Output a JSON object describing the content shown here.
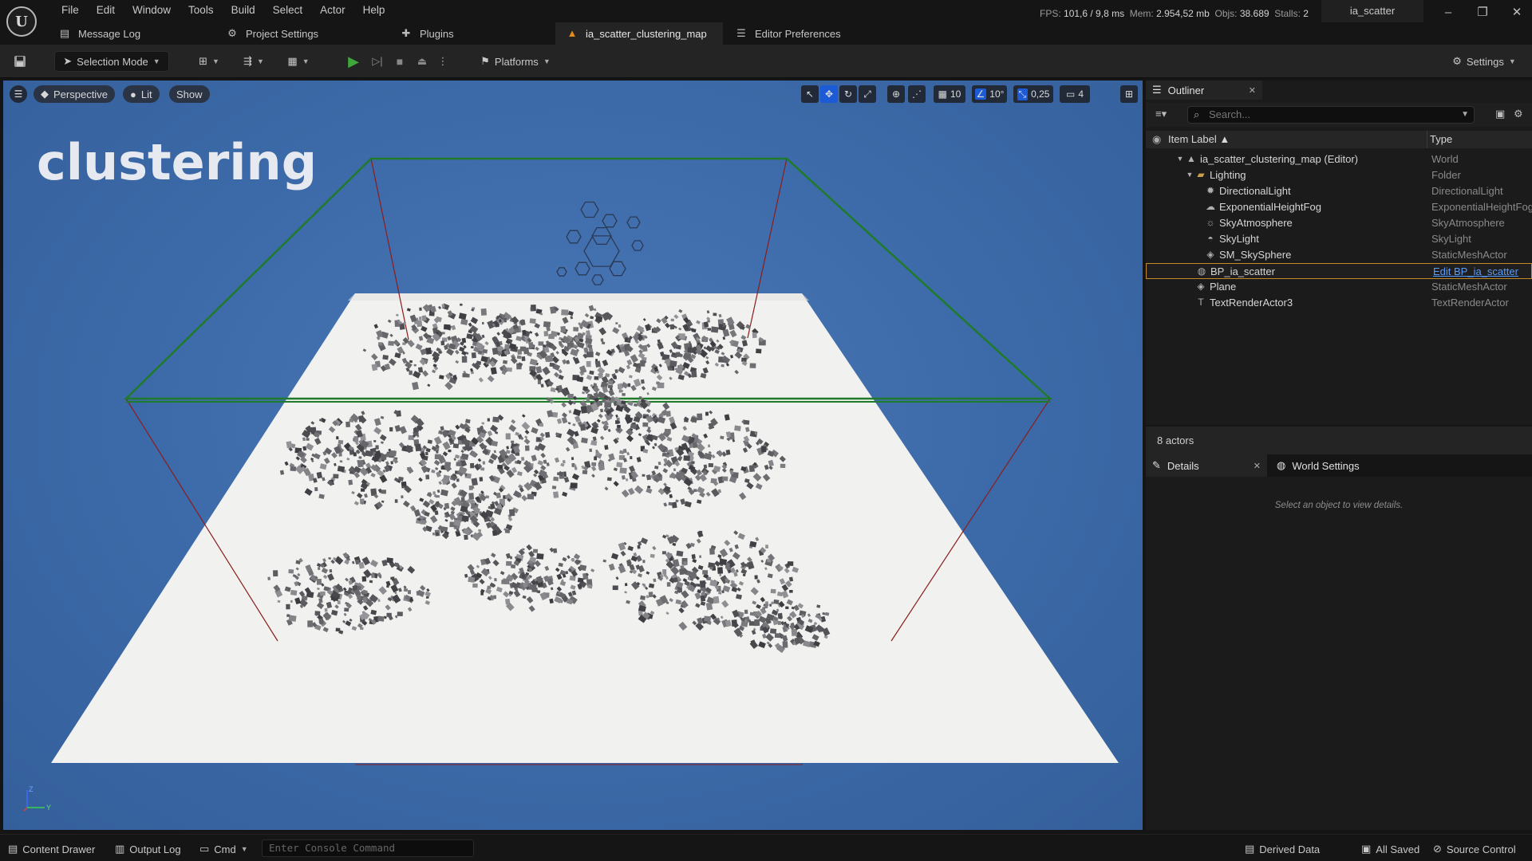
{
  "menu": [
    "File",
    "Edit",
    "Window",
    "Tools",
    "Build",
    "Select",
    "Actor",
    "Help"
  ],
  "stats": {
    "fps_label": "FPS:",
    "fps": "101,6",
    "ms": "/ 9,8 ms",
    "mem_label": "Mem:",
    "mem": "2.954,52 mb",
    "objs_label": "Objs:",
    "objs": "38.689",
    "stalls_label": "Stalls:",
    "stalls": "2"
  },
  "project_name": "ia_scatter",
  "window_controls": {
    "minimize": "–",
    "restore": "❐",
    "close": "✕"
  },
  "tabs": {
    "message_log": "Message Log",
    "project_settings": "Project Settings",
    "plugins": "Plugins",
    "level": "ia_scatter_clustering_map",
    "editor_prefs": "Editor Preferences"
  },
  "toolbar": {
    "selection_mode": "Selection Mode",
    "platforms": "Platforms",
    "settings": "Settings"
  },
  "viewport": {
    "perspective": "Perspective",
    "lit": "Lit",
    "show": "Show",
    "grid_snap": "10",
    "rot_snap": "10°",
    "scale_snap": "0,25",
    "camera_speed": "4",
    "world_text": "clustering",
    "axis_z": "Z",
    "axis_y": "Y"
  },
  "outliner": {
    "title": "Outliner",
    "search_placeholder": "Search...",
    "col_label": "Item Label ▲",
    "col_type": "Type",
    "rows": [
      {
        "label": "ia_scatter_clustering_map (Editor)",
        "type": "World"
      },
      {
        "label": "Lighting",
        "type": "Folder"
      },
      {
        "label": "DirectionalLight",
        "type": "DirectionalLight"
      },
      {
        "label": "ExponentialHeightFog",
        "type": "ExponentialHeightFog"
      },
      {
        "label": "SkyAtmosphere",
        "type": "SkyAtmosphere"
      },
      {
        "label": "SkyLight",
        "type": "SkyLight"
      },
      {
        "label": "SM_SkySphere",
        "type": "StaticMeshActor"
      },
      {
        "label": "BP_ia_scatter",
        "type": "Edit BP_ia_scatter"
      },
      {
        "label": "Plane",
        "type": "StaticMeshActor"
      },
      {
        "label": "TextRenderActor3",
        "type": "TextRenderActor"
      }
    ],
    "footer": "8 actors"
  },
  "details": {
    "tab_details": "Details",
    "tab_world": "World Settings",
    "empty_message": "Select an object to view details."
  },
  "statusbar": {
    "content_drawer": "Content Drawer",
    "output_log": "Output Log",
    "cmd": "Cmd",
    "console_placeholder": "Enter Console Command",
    "derived_data": "Derived Data",
    "all_saved": "All Saved",
    "source_control": "Source Control"
  },
  "colors": {
    "accent_blue": "#1d5bd6",
    "play_green": "#3fa63a",
    "selection_orange": "#c48a2a",
    "viewport_sky": "#4a78b6"
  }
}
